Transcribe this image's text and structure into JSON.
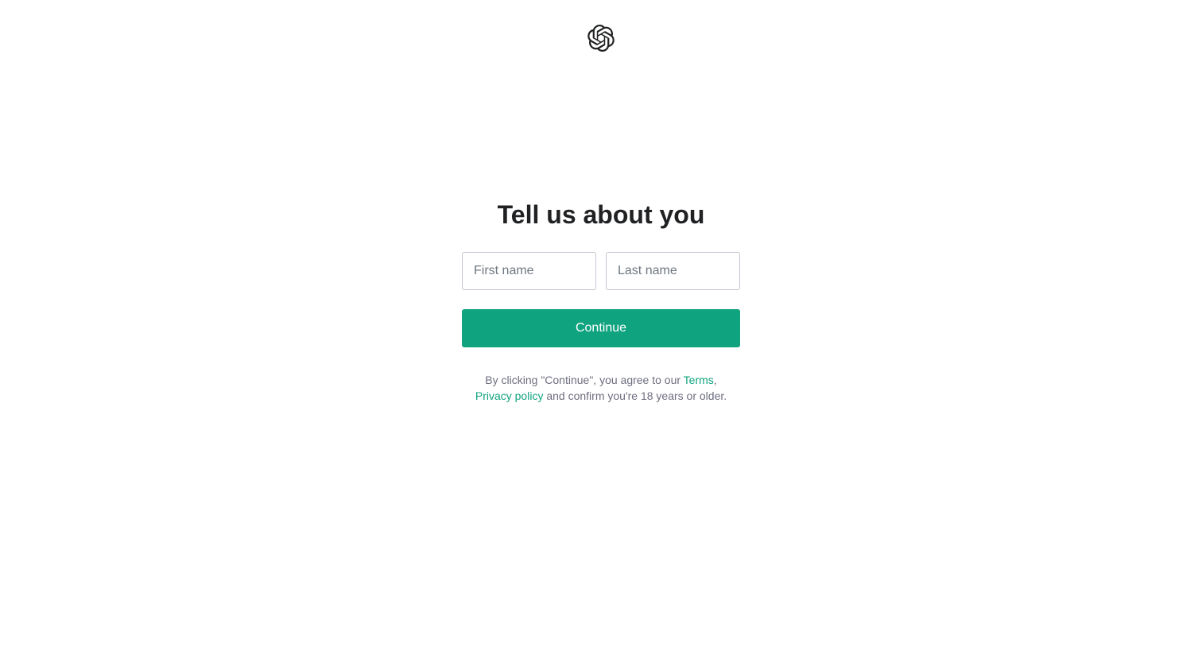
{
  "header": {
    "logo_icon": "openai-logo-icon"
  },
  "form": {
    "title": "Tell us about you",
    "first_name": {
      "value": "",
      "placeholder": "First name"
    },
    "last_name": {
      "value": "",
      "placeholder": "Last name"
    },
    "continue_label": "Continue"
  },
  "legal": {
    "prefix": "By clicking \"Continue\", you agree to our ",
    "terms_label": "Terms",
    "comma": ",",
    "privacy_label": "Privacy policy",
    "suffix": " and confirm you're 18 years or older."
  },
  "colors": {
    "accent": "#10a37f",
    "heading": "#202123",
    "muted_text": "#6e6e80",
    "input_border": "#c2c8d0"
  }
}
